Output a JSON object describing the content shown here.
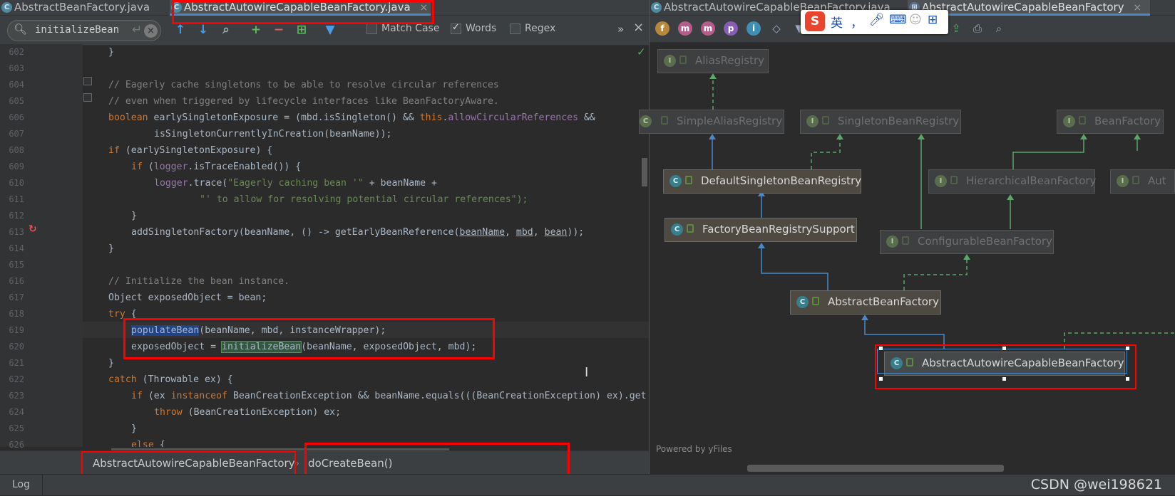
{
  "left_tabs": [
    {
      "label": "AbstractBeanFactory.java",
      "icon": "C"
    },
    {
      "label": "AbstractAutowireCapableBeanFactory.java",
      "icon": "C",
      "close": "×"
    }
  ],
  "find": {
    "query": "initializeBean",
    "match_case": "Match Case",
    "words": "Words",
    "regex": "Regex",
    "more": "»",
    "close": "×"
  },
  "lines": [
    {
      "n": "602",
      "code": "}"
    },
    {
      "n": "603",
      "code": ""
    },
    {
      "n": "604",
      "code": "// Eagerly cache singletons to be able to resolve circular references"
    },
    {
      "n": "605",
      "code": "// even when triggered by lifecycle interfaces like BeanFactoryAware."
    },
    {
      "n": "606",
      "code": "boolean earlySingletonExposure = (mbd.isSingleton() && this.allowCircularReferences &&"
    },
    {
      "n": "607",
      "code": "isSingletonCurrentlyInCreation(beanName));"
    },
    {
      "n": "608",
      "code": "if (earlySingletonExposure) {"
    },
    {
      "n": "609",
      "code": "if (logger.isTraceEnabled()) {"
    },
    {
      "n": "610",
      "code": "logger.trace(\"Eagerly caching bean '\" + beanName +"
    },
    {
      "n": "611",
      "code": "\"' to allow for resolving potential circular references\");"
    },
    {
      "n": "612",
      "code": "}"
    },
    {
      "n": "613",
      "code": "addSingletonFactory(beanName, () -> getEarlyBeanReference(beanName, mbd, bean));"
    },
    {
      "n": "614",
      "code": "}"
    },
    {
      "n": "615",
      "code": ""
    },
    {
      "n": "616",
      "code": "// Initialize the bean instance."
    },
    {
      "n": "617",
      "code": "Object exposedObject = bean;"
    },
    {
      "n": "618",
      "code": "try {"
    },
    {
      "n": "619",
      "code": "populateBean(beanName, mbd, instanceWrapper);"
    },
    {
      "n": "620",
      "code": "exposedObject = initializeBean(beanName, exposedObject, mbd);"
    },
    {
      "n": "621",
      "code": "}"
    },
    {
      "n": "622",
      "code": "catch (Throwable ex) {"
    },
    {
      "n": "623",
      "code": "if (ex instanceof BeanCreationException && beanName.equals(((BeanCreationException) ex).get"
    },
    {
      "n": "624",
      "code": "throw (BeanCreationException) ex;"
    },
    {
      "n": "625",
      "code": "}"
    },
    {
      "n": "626",
      "code": "else {"
    }
  ],
  "breadcrumb": {
    "class": "AbstractAutowireCapableBeanFactory",
    "method": "doCreateBean()"
  },
  "right_tabs": [
    {
      "label": "AbstractAutowireCapableBeanFactory.java"
    },
    {
      "label": "AbstractAutowireCapableBeanFactory",
      "close": "×"
    }
  ],
  "toolbar_icons": [
    "f",
    "m",
    "m",
    "p",
    "i"
  ],
  "ime": {
    "brand": "S",
    "lang": "英",
    "punct": "，"
  },
  "diagram": {
    "nodes": [
      {
        "id": "alias",
        "label": "AliasRegistry",
        "kind": "I"
      },
      {
        "id": "simplealias",
        "label": "SimpleAliasRegistry",
        "kind": "C"
      },
      {
        "id": "singletonreg",
        "label": "SingletonBeanRegistry",
        "kind": "I"
      },
      {
        "id": "beanfactory",
        "label": "BeanFactory",
        "kind": "I"
      },
      {
        "id": "defaultsingleton",
        "label": "DefaultSingletonBeanRegistry",
        "kind": "C"
      },
      {
        "id": "hierarchical",
        "label": "HierarchicalBeanFactory",
        "kind": "I"
      },
      {
        "id": "autcut",
        "label": "Aut",
        "kind": "I"
      },
      {
        "id": "factorybean",
        "label": "FactoryBeanRegistrySupport",
        "kind": "C"
      },
      {
        "id": "configurable",
        "label": "ConfigurableBeanFactory",
        "kind": "I"
      },
      {
        "id": "abstractbf",
        "label": "AbstractBeanFactory",
        "kind": "C"
      },
      {
        "id": "autowire",
        "label": "AbstractAutowireCapableBeanFactory",
        "kind": "C"
      }
    ],
    "powered": "Powered by yFiles"
  },
  "status": {
    "log": "Log",
    "watermark": "CSDN @wei198621"
  },
  "colors": {
    "accent": "#4a88c7",
    "annotation": "#ff0000"
  }
}
